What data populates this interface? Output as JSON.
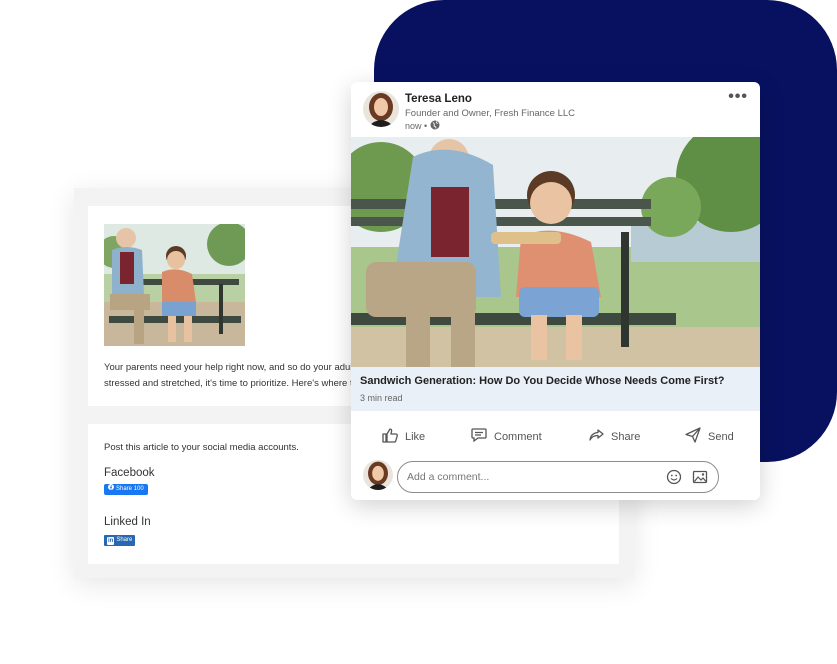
{
  "article": {
    "excerpt_line1": "Your parents need your help right now, and so do your adult kids. If you're feeling",
    "excerpt_line2": "stressed and stretched, it's time to prioritize. Here's where to start."
  },
  "share": {
    "intro": "Post this article to your social media accounts.",
    "facebook_label": "Facebook",
    "facebook_button": "Share 100",
    "linkedin_label": "Linked In",
    "linkedin_button": "Share",
    "linkedin_badge": "in"
  },
  "post": {
    "author_name": "Teresa Leno",
    "author_title": "Founder and Owner, Fresh Finance LLC",
    "time": "now •",
    "more": "•••",
    "link_title": "Sandwich Generation: How Do You Decide Whose Needs Come First?",
    "read_time": "3 min read",
    "actions": {
      "like": "Like",
      "comment": "Comment",
      "share": "Share",
      "send": "Send"
    },
    "comment_placeholder": "Add a comment..."
  },
  "colors": {
    "navy": "#071160",
    "linkedin_blue": "#2867b2",
    "facebook_blue": "#1877f2",
    "link_box_bg": "#eaf0f7"
  },
  "icons": [
    "globe-icon",
    "like-icon",
    "comment-icon",
    "share-icon",
    "send-icon",
    "emoji-icon",
    "image-icon",
    "more-icon",
    "facebook-icon",
    "linkedin-icon"
  ]
}
